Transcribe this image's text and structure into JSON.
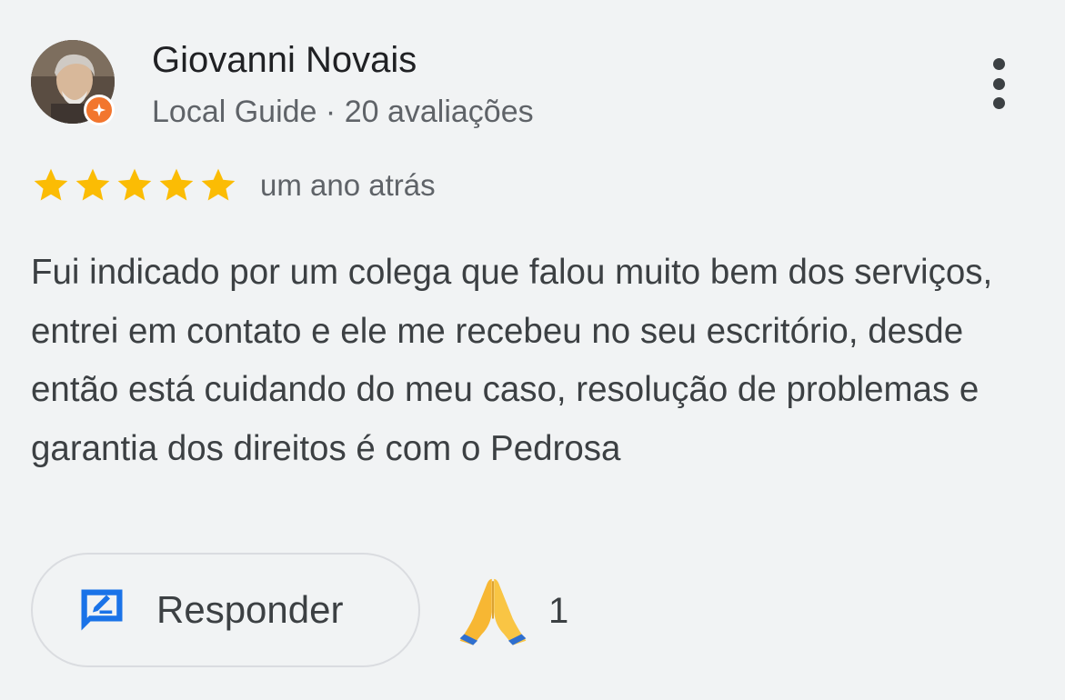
{
  "review": {
    "author": {
      "name": "Giovanni Novais",
      "badge": "Local Guide",
      "separator": "·",
      "reviews_count": "20 avaliações",
      "badge_color": "#f2762e"
    },
    "rating": {
      "value": 5,
      "max": 5,
      "star_color": "#fbbc04"
    },
    "time_ago": "um ano atrás",
    "text": "Fui indicado por um colega que falou muito bem dos serviços, entrei em contato e ele me recebeu no seu escritório, desde então está cuidando do meu caso, resolução de problemas e garantia dos direitos é com o Pedrosa",
    "actions": {
      "reply_label": "Responder",
      "reply_icon": "reply-edit-icon",
      "reaction_icon": "folded-hands-icon",
      "reaction_count": "1",
      "more_icon": "more-vert-icon",
      "accent_color": "#1a73e8"
    }
  }
}
